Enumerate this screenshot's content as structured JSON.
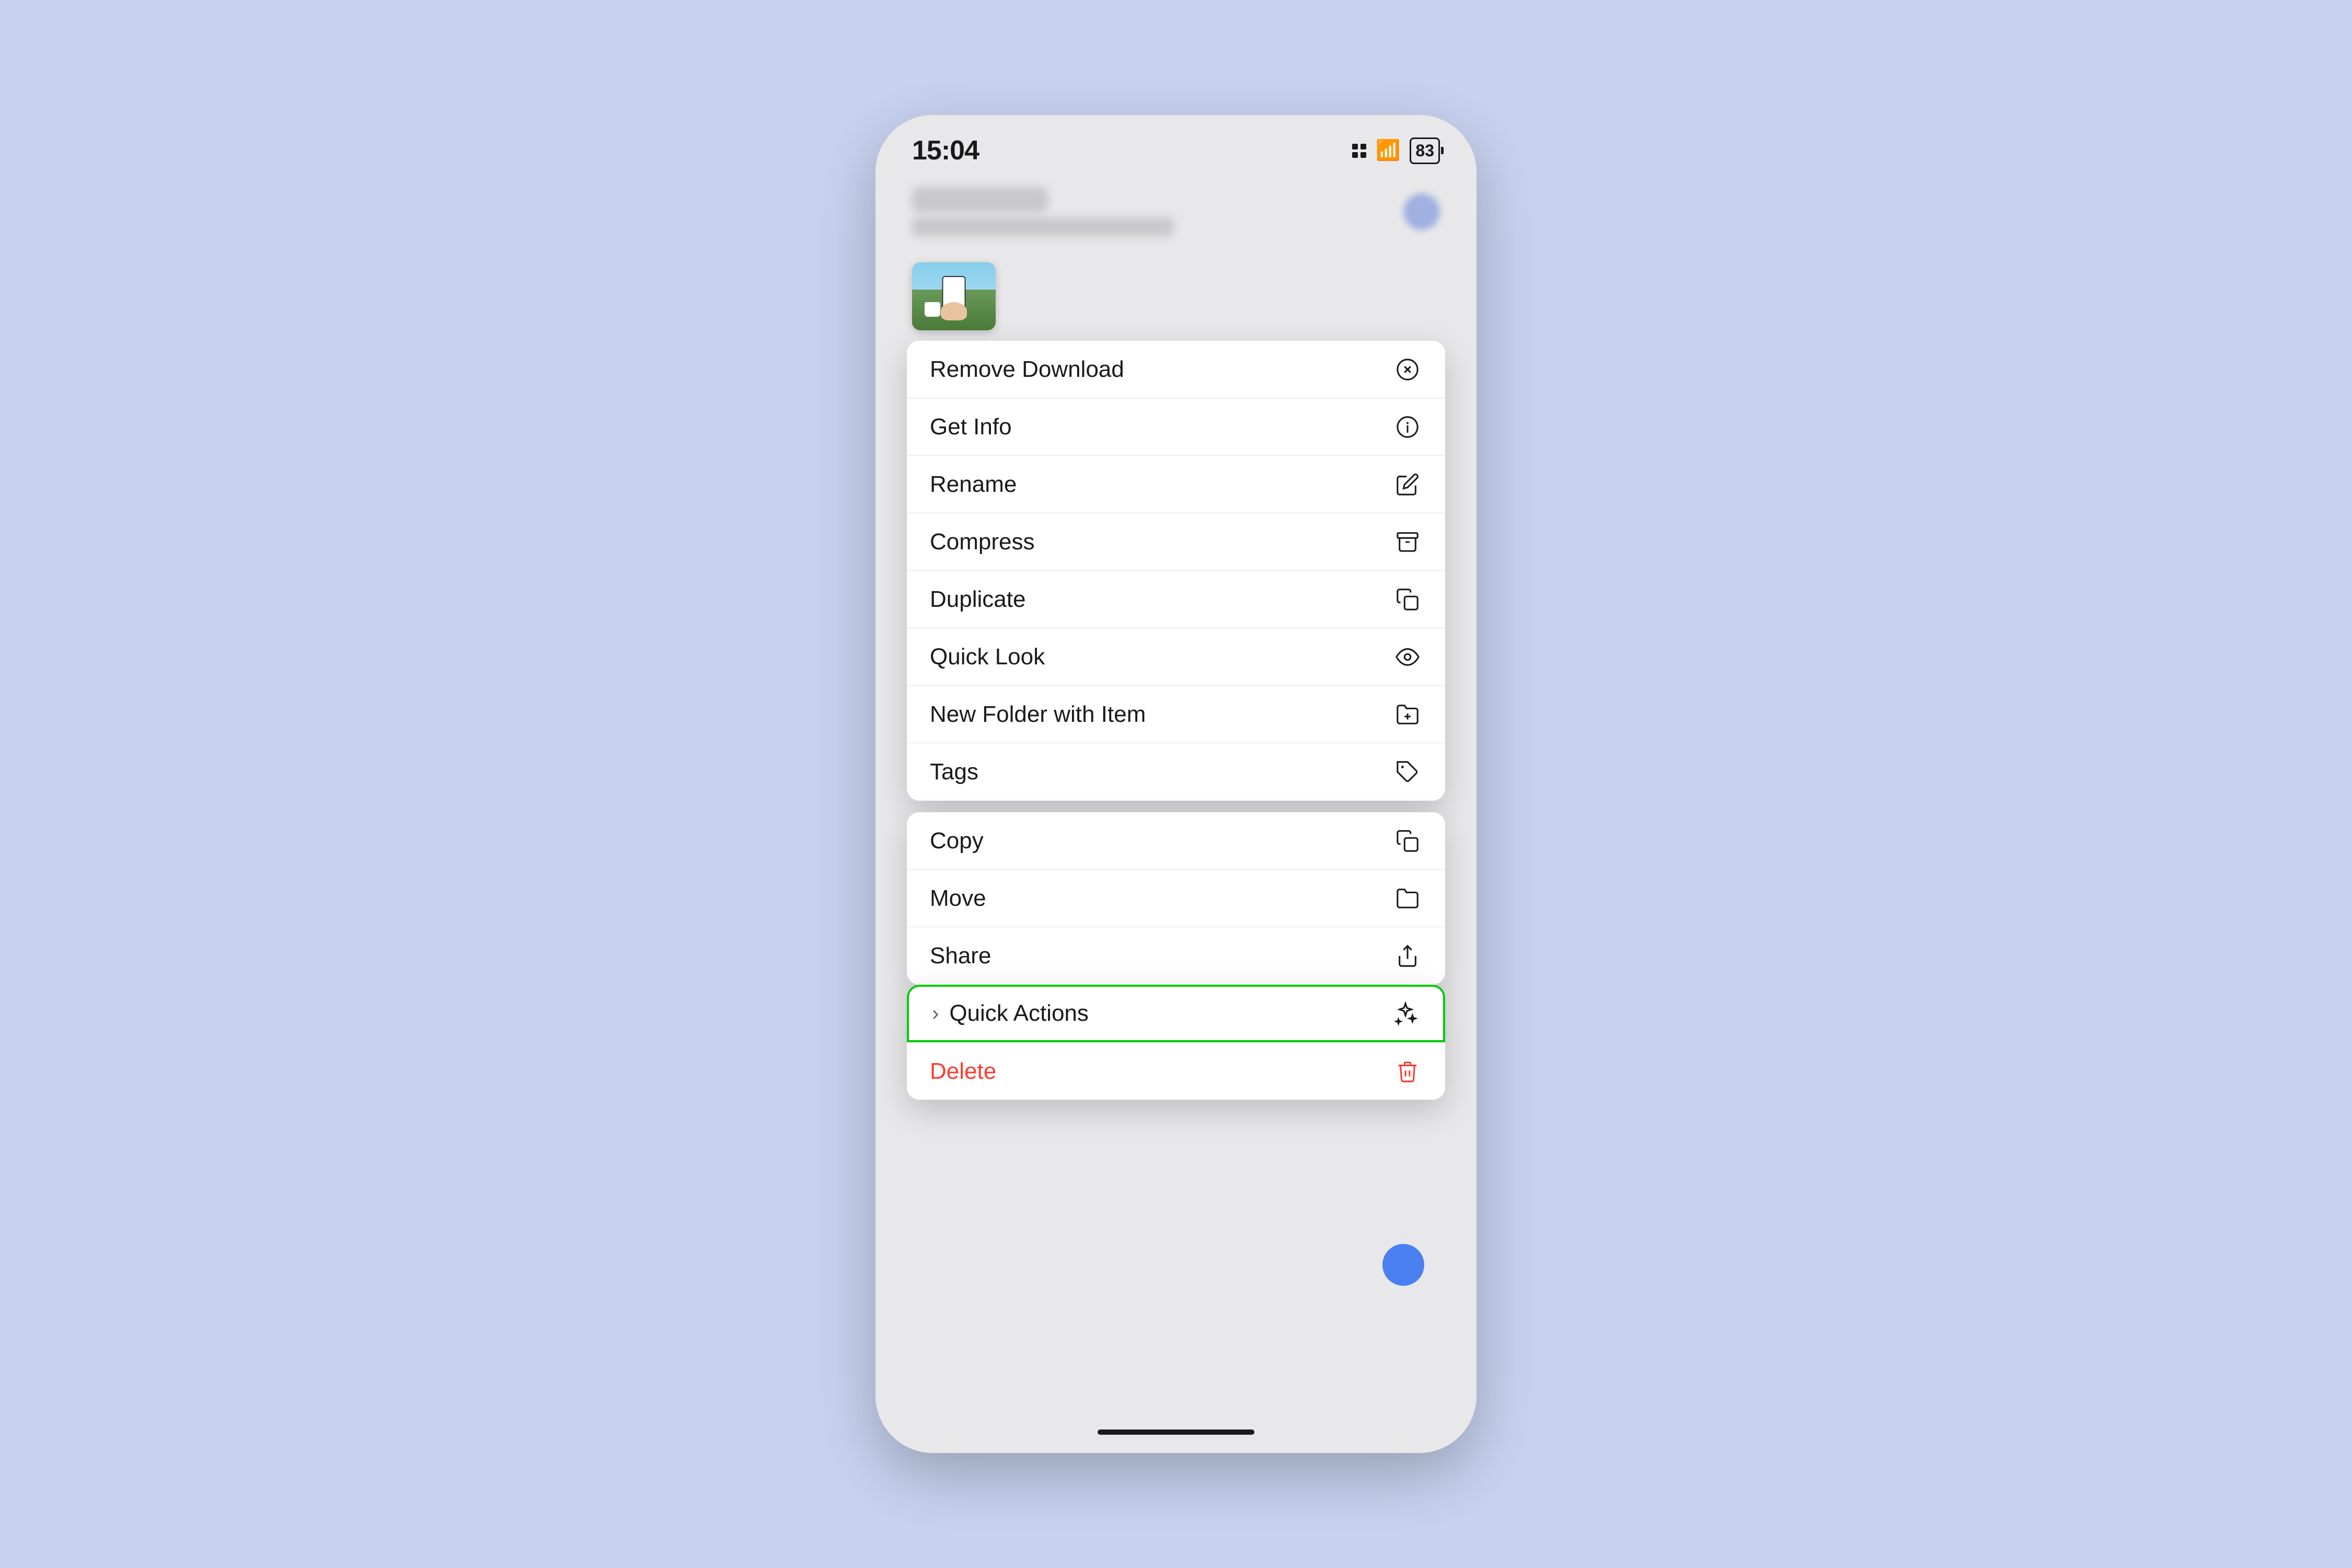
{
  "status_bar": {
    "time": "15:04",
    "battery": "83"
  },
  "header": {
    "title_placeholder": "",
    "subtitle_placeholder": ""
  },
  "menu_groups": [
    {
      "id": "group1",
      "items": [
        {
          "id": "remove-download",
          "label": "Remove Download",
          "icon": "circle-x"
        },
        {
          "id": "get-info",
          "label": "Get Info",
          "icon": "circle-i"
        },
        {
          "id": "rename",
          "label": "Rename",
          "icon": "pencil"
        },
        {
          "id": "compress",
          "label": "Compress",
          "icon": "archive"
        },
        {
          "id": "duplicate",
          "label": "Duplicate",
          "icon": "duplicate"
        },
        {
          "id": "quick-look",
          "label": "Quick Look",
          "icon": "eye"
        },
        {
          "id": "new-folder",
          "label": "New Folder with Item",
          "icon": "folder-plus"
        },
        {
          "id": "tags",
          "label": "Tags",
          "icon": "tag"
        }
      ]
    },
    {
      "id": "group2",
      "items": [
        {
          "id": "copy",
          "label": "Copy",
          "icon": "copy"
        },
        {
          "id": "move",
          "label": "Move",
          "icon": "folder"
        },
        {
          "id": "share",
          "label": "Share",
          "icon": "share"
        }
      ]
    },
    {
      "id": "group3",
      "items": [
        {
          "id": "quick-actions",
          "label": "Quick Actions",
          "icon": "sparkles",
          "highlighted": true,
          "has_chevron": true
        }
      ]
    },
    {
      "id": "group4",
      "items": [
        {
          "id": "delete",
          "label": "Delete",
          "icon": "trash",
          "destructive": true
        }
      ]
    }
  ]
}
